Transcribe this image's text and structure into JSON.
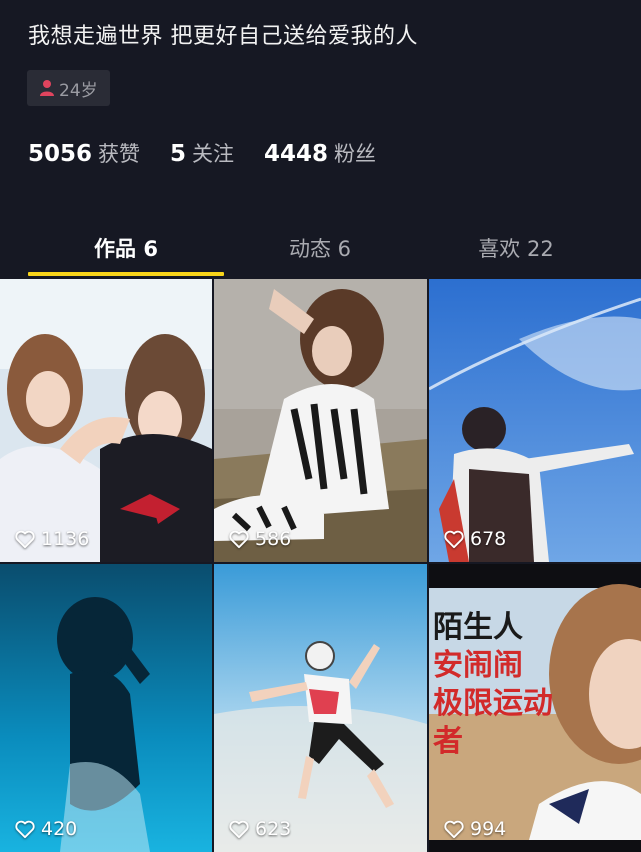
{
  "profile": {
    "bio": "我想走遍世界 把更好自己送给爱我的人",
    "age_badge": "24岁",
    "stats": [
      {
        "value": "5056",
        "label": "获赞"
      },
      {
        "value": "5",
        "label": "关注"
      },
      {
        "value": "4448",
        "label": "粉丝"
      }
    ]
  },
  "tabs": [
    {
      "label": "作品 6",
      "active": true
    },
    {
      "label": "动态 6",
      "active": false
    },
    {
      "label": "喜欢 22",
      "active": false
    }
  ],
  "videos": [
    {
      "likes": "1136"
    },
    {
      "likes": "586"
    },
    {
      "likes": "678"
    },
    {
      "likes": "420"
    },
    {
      "likes": "623"
    },
    {
      "likes": "994"
    }
  ],
  "video6_overlay": [
    "陌生人",
    "安闹闹",
    "极限运动",
    "者"
  ],
  "colors": {
    "background": "#161823",
    "accent_underline": "#f8d41a",
    "badge_bg": "#2a2c36"
  },
  "icons": {
    "age_badge_icon": "person-icon",
    "likes_icon": "heart-outline-icon"
  }
}
